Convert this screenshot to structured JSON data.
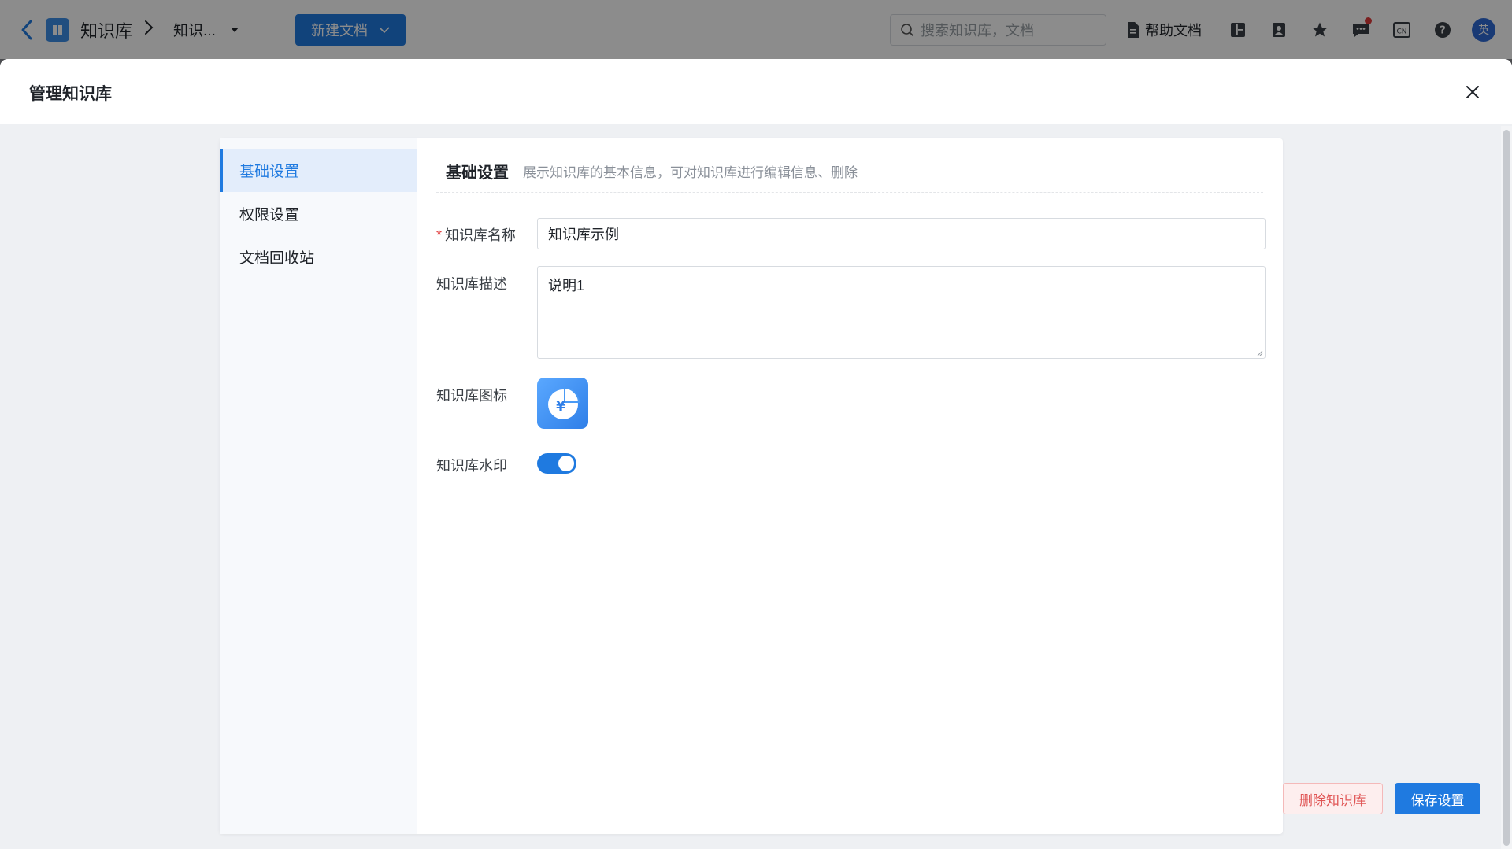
{
  "topbar": {
    "app_title": "知识库",
    "breadcrumb_current": "知识...",
    "new_doc_label": "新建文档",
    "search_placeholder": "搜索知识库，文档",
    "help_label": "帮助文档",
    "avatar_text": "英"
  },
  "drawer": {
    "title": "管理知识库"
  },
  "side_nav": {
    "items": [
      {
        "label": "基础设置"
      },
      {
        "label": "权限设置"
      },
      {
        "label": "文档回收站"
      }
    ]
  },
  "section": {
    "title": "基础设置",
    "description": "展示知识库的基本信息，可对知识库进行编辑信息、删除"
  },
  "form": {
    "name_label": "知识库名称",
    "name_value": "知识库示例",
    "desc_label": "知识库描述",
    "desc_value": "说明1",
    "icon_label": "知识库图标",
    "icon_glyph": "¥",
    "watermark_label": "知识库水印",
    "watermark_enabled": true
  },
  "actions": {
    "delete_label": "删除知识库",
    "save_label": "保存设置"
  },
  "colors": {
    "primary": "#1f7ae0",
    "danger": "#e05555"
  }
}
